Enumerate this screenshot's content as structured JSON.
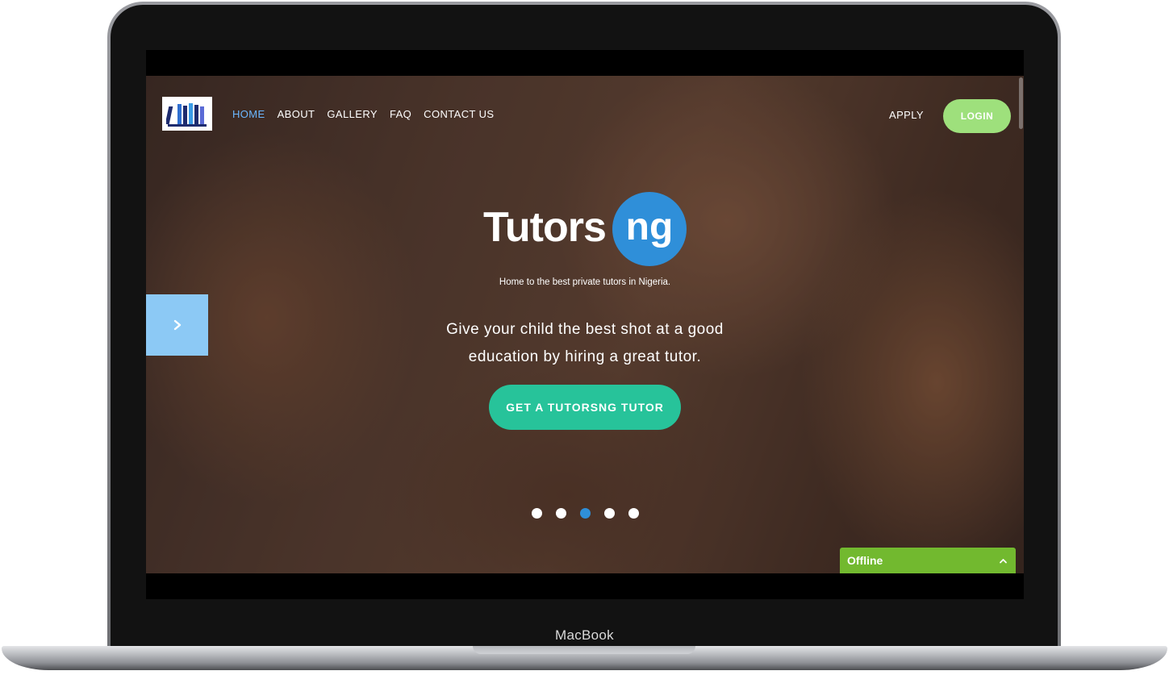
{
  "device": {
    "brand_label": "MacBook"
  },
  "header": {
    "nav": [
      {
        "label": "HOME",
        "active": true
      },
      {
        "label": "ABOUT",
        "active": false
      },
      {
        "label": "GALLERY",
        "active": false
      },
      {
        "label": "FAQ",
        "active": false
      },
      {
        "label": "CONTACT US",
        "active": false
      }
    ],
    "apply_label": "APPLY",
    "login_label": "LOGIN"
  },
  "hero": {
    "logo_word": "Tutors",
    "logo_accent": "ng",
    "tagline": "Home to the best private tutors in Nigeria.",
    "headline": "Give your child the best shot at a good education by hiring a great tutor.",
    "cta_label": "GET A TUTORSNG TUTOR"
  },
  "slider": {
    "next_icon": "chevron-right-icon",
    "dot_count": 5,
    "active_dot": 3
  },
  "chat": {
    "status_label": "Offline",
    "toggle_icon": "chevron-up-icon"
  },
  "colors": {
    "nav_active": "#6bb7ff",
    "login_bg": "#9ee07c",
    "cta_bg": "#27c39a",
    "logo_circle": "#2f8fd9",
    "slider_next_bg": "#8cc9f5",
    "chat_bg": "#72b92f"
  }
}
